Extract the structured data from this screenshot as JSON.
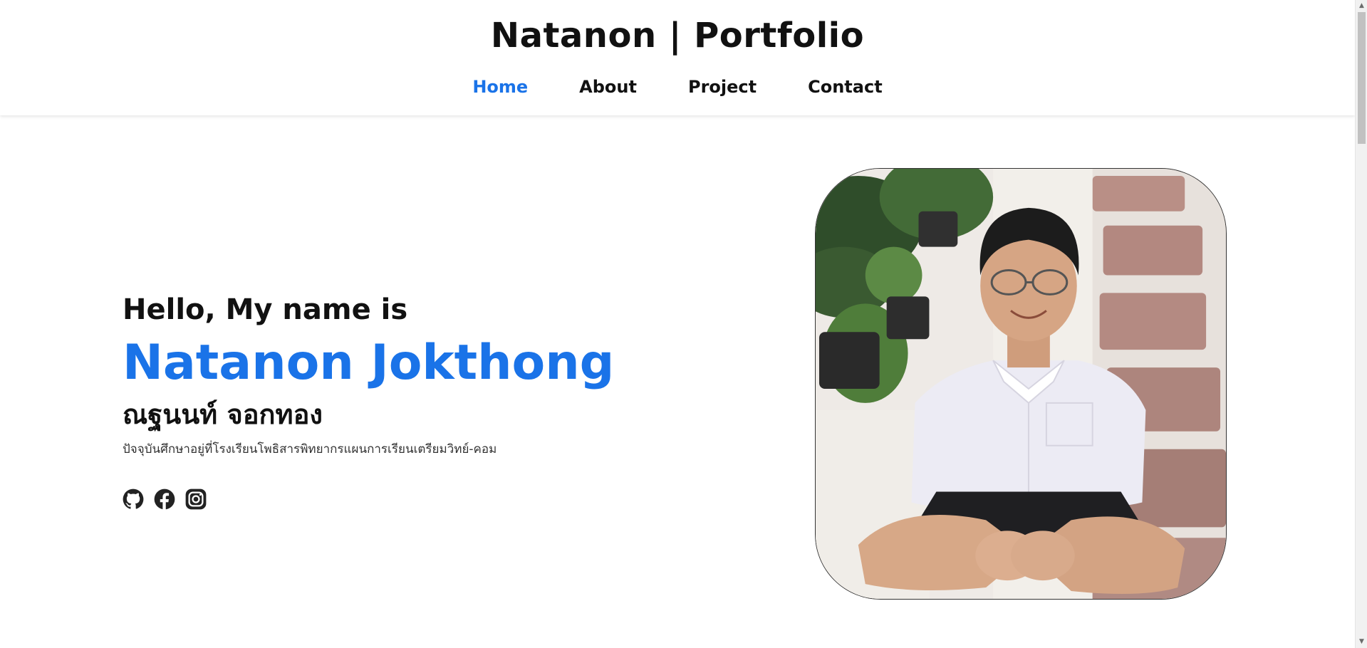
{
  "header": {
    "title": "Natanon | Portfolio",
    "nav": [
      {
        "label": "Home",
        "active": true
      },
      {
        "label": "About",
        "active": false
      },
      {
        "label": "Project",
        "active": false
      },
      {
        "label": "Contact",
        "active": false
      }
    ]
  },
  "hero": {
    "greeting": "Hello, My name is",
    "name_en": "Natanon Jokthong",
    "name_th": "ณฐนนท์ จอกทอง",
    "description": "ปัจจุบันศึกษาอยู่ที่โรงเรียนโพธิสารพิทยากรแผนการเรียนเตรียมวิทย์-คอม"
  },
  "socials": [
    {
      "icon": "github-icon"
    },
    {
      "icon": "facebook-icon"
    },
    {
      "icon": "instagram-icon"
    }
  ],
  "photo": {
    "subject": "profile-photo"
  },
  "colors": {
    "accent": "#1a73e8",
    "text": "#111111",
    "background": "#ffffff"
  }
}
